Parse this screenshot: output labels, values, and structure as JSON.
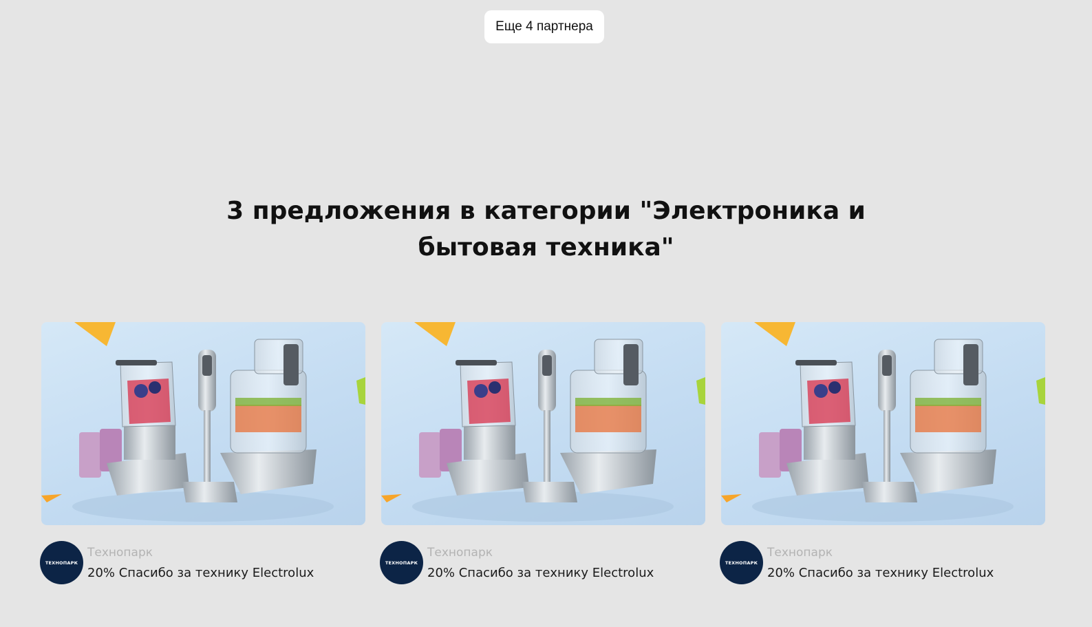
{
  "more_partners_button": {
    "label": "Еще 4 партнера"
  },
  "section": {
    "title": "3 предложения в категории \"Электроника и бытовая техника\""
  },
  "offers": [
    {
      "partner_name": "Технопарк",
      "partner_logo_text": "ТЕХНОПАРК",
      "title": "20% Спасибо за технику Electrolux"
    },
    {
      "partner_name": "Технопарк",
      "partner_logo_text": "ТЕХНОПАРК",
      "title": "20% Спасибо за технику Electrolux"
    },
    {
      "partner_name": "Технопарк",
      "partner_logo_text": "ТЕХНОПАРК",
      "title": "20% Спасибо за технику Electrolux"
    }
  ],
  "colors": {
    "page_background": "#e5e5e5",
    "logo_background": "#0c2446",
    "partner_name": "#b3b3b3",
    "accent_yellow": "#f7b733"
  }
}
